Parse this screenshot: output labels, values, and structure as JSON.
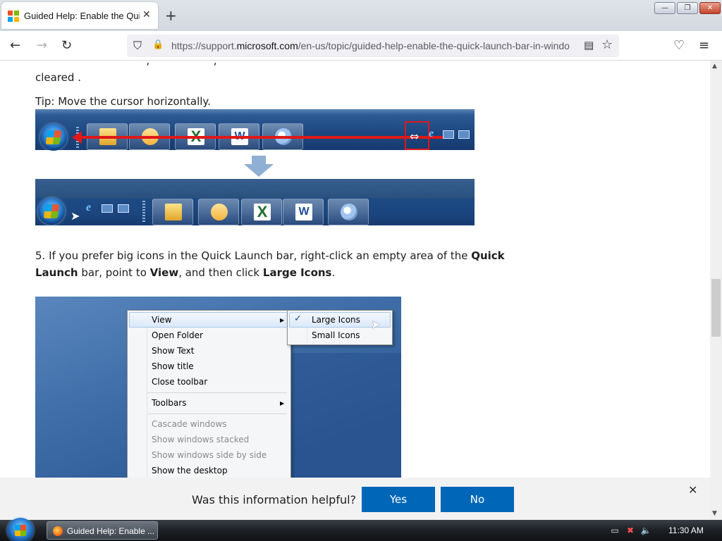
{
  "browser": {
    "tab_title": "Guided Help: Enable the Quick L",
    "tab_close": "✕",
    "new_tab": "+",
    "url_prefix": "https://support.",
    "url_domain": "microsoft.com",
    "url_rest": "/en-us/topic/guided-help-enable-the-quick-launch-bar-in-windo",
    "window_buttons": {
      "minimize": "—",
      "restore": "❐",
      "close": "✕"
    }
  },
  "nav_icons": {
    "back": "←",
    "forward": "→",
    "reload": "↻",
    "shield": "⛉",
    "lock": "🔒",
    "reader": "▤",
    "star": "☆",
    "pocket": "♡",
    "menu": "≡"
  },
  "article": {
    "top_line_1": "                                 ,                   ,                                                              ",
    "top_word": "cleared .",
    "tip": "Tip: Move the cursor horizontally.",
    "step5": {
      "p1": "5. If you prefer big icons in the Quick Launch bar, right-click an empty area of the ",
      "b1": "Quick Launch",
      "p2": " bar, point to ",
      "b2": "View",
      "p3": ", and then click ",
      "b3": "Large Icons",
      "p4": "."
    }
  },
  "context_menu": {
    "items": [
      {
        "label": "View",
        "submenu": true
      },
      {
        "label": "Open Folder"
      },
      {
        "label": "Show Text"
      },
      {
        "label": "Show title"
      },
      {
        "label": "Close toolbar"
      },
      {
        "label": "Toolbars",
        "submenu": true
      },
      {
        "label": "Cascade windows",
        "disabled": true
      },
      {
        "label": "Show windows stacked",
        "disabled": true
      },
      {
        "label": "Show windows side by side",
        "disabled": true
      },
      {
        "label": "Show the desktop"
      }
    ],
    "submenu_items": [
      {
        "label": "Large Icons",
        "checked": true
      },
      {
        "label": "Small Icons"
      }
    ],
    "check": "✓",
    "arrow": "▶"
  },
  "feedback": {
    "question": "Was this information helpful?",
    "yes": "Yes",
    "no": "No",
    "close": "✕"
  },
  "taskbar": {
    "task_label": "Guided Help: Enable ...",
    "clock": "11:30 AM"
  },
  "colors": {
    "accent": "#0067b8",
    "ms_red": "#f25022",
    "ms_green": "#7fba00",
    "ms_blue": "#00a4ef",
    "ms_yellow": "#ffb900",
    "annotation_red": "#e01818"
  }
}
